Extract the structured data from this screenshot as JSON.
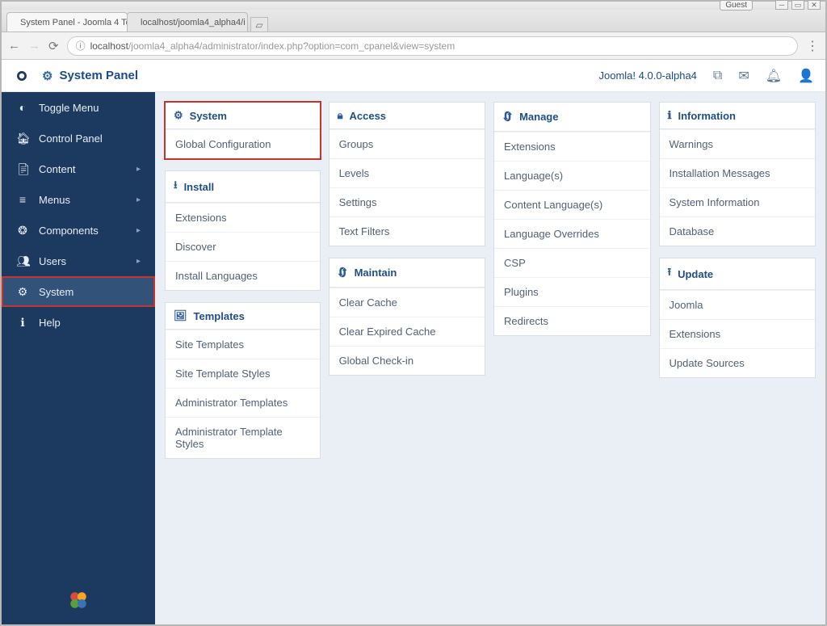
{
  "browser": {
    "guest_label": "Guest",
    "tabs": [
      {
        "title": "System Panel - Joomla 4 Te"
      },
      {
        "title": "localhost/joomla4_alpha4/i"
      }
    ],
    "url_prefix": "localhost",
    "url_rest": "/joomla4_alpha4/administrator/index.php?option=com_cpanel&view=system"
  },
  "header": {
    "title": "System Panel",
    "version": "Joomla! 4.0.0-alpha4"
  },
  "sidebar": {
    "items": [
      {
        "label": "Toggle Menu"
      },
      {
        "label": "Control Panel"
      },
      {
        "label": "Content"
      },
      {
        "label": "Menus"
      },
      {
        "label": "Components"
      },
      {
        "label": "Users"
      },
      {
        "label": "System"
      },
      {
        "label": "Help"
      }
    ]
  },
  "panels": {
    "col0": [
      {
        "title": "System",
        "icon": "gear",
        "highlight": true,
        "links": [
          "Global Configuration"
        ]
      },
      {
        "title": "Install",
        "icon": "download",
        "links": [
          "Extensions",
          "Discover",
          "Install Languages"
        ]
      },
      {
        "title": "Templates",
        "icon": "image",
        "links": [
          "Site Templates",
          "Site Template Styles",
          "Administrator Templates",
          "Administrator Template Styles"
        ]
      }
    ],
    "col1": [
      {
        "title": "Access",
        "icon": "lock",
        "links": [
          "Groups",
          "Levels",
          "Settings",
          "Text Filters"
        ]
      },
      {
        "title": "Maintain",
        "icon": "refresh",
        "links": [
          "Clear Cache",
          "Clear Expired Cache",
          "Global Check-in"
        ]
      }
    ],
    "col2": [
      {
        "title": "Manage",
        "icon": "refresh",
        "links": [
          "Extensions",
          "Language(s)",
          "Content Language(s)",
          "Language Overrides",
          "CSP",
          "Plugins",
          "Redirects"
        ]
      }
    ],
    "col3": [
      {
        "title": "Information",
        "icon": "info",
        "links": [
          "Warnings",
          "Installation Messages",
          "System Information",
          "Database"
        ]
      },
      {
        "title": "Update",
        "icon": "upload",
        "links": [
          "Joomla",
          "Extensions",
          "Update Sources"
        ]
      }
    ]
  }
}
